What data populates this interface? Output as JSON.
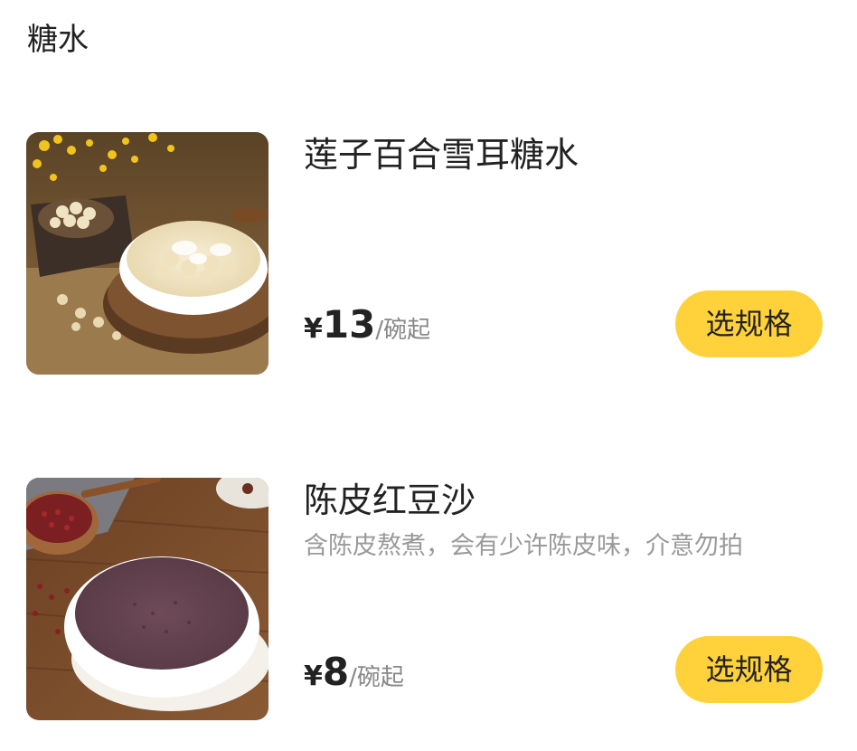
{
  "section": {
    "title": "糖水"
  },
  "products": [
    {
      "name": "莲子百合雪耳糖水",
      "description": "",
      "currency": "¥",
      "price": "13",
      "unit": "/碗起",
      "button_label": "选规格"
    },
    {
      "name": "陈皮红豆沙",
      "description": "含陈皮熬煮，会有少许陈皮味，介意勿拍",
      "currency": "¥",
      "price": "8",
      "unit": "/碗起",
      "button_label": "选规格"
    }
  ],
  "colors": {
    "button": "#ffd23c",
    "title_text": "#222222",
    "desc_text": "#9a9a9a"
  }
}
